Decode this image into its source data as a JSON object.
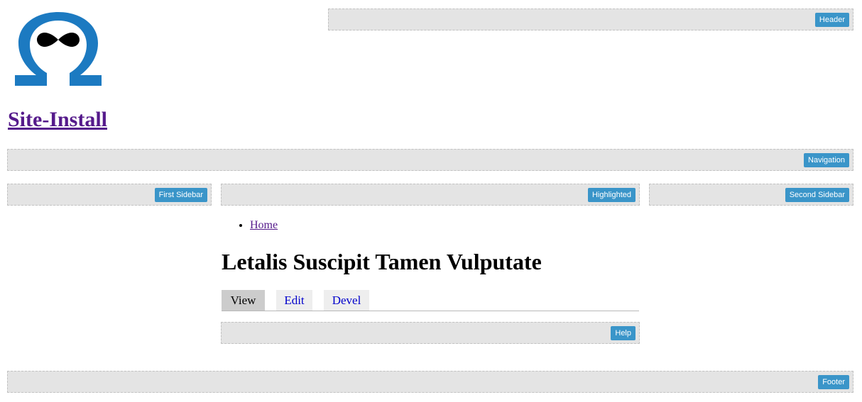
{
  "site": {
    "name": "Site-Install",
    "logo_icon": "omega-logo-icon",
    "logo_color": "#1c7ac1"
  },
  "regions": {
    "header": "Header",
    "navigation": "Navigation",
    "first_sidebar": "First Sidebar",
    "highlighted": "Highlighted",
    "second_sidebar": "Second Sidebar",
    "help": "Help",
    "footer": "Footer"
  },
  "breadcrumb": {
    "items": [
      {
        "label": "Home"
      }
    ]
  },
  "main": {
    "title": "Letalis Suscipit Tamen Vulputate",
    "tabs": [
      {
        "label": "View",
        "active": true
      },
      {
        "label": "Edit",
        "active": false
      },
      {
        "label": "Devel",
        "active": false
      }
    ]
  },
  "colors": {
    "region_bg": "#e4e4e4",
    "region_label_bg": "#3a95c9",
    "link_visited": "#551a8b",
    "tab_link": "#0000cc"
  }
}
